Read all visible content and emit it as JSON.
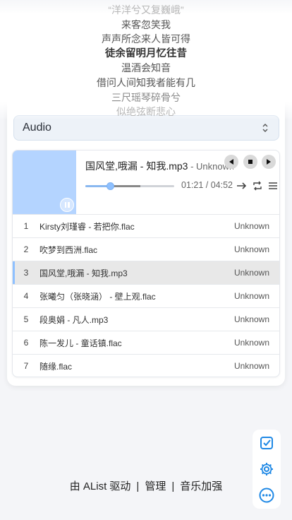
{
  "lyrics": [
    {
      "text": "“洋洋兮又复巍峨”",
      "state": "faint"
    },
    {
      "text": "来客忽笑我",
      "state": "normal"
    },
    {
      "text": "声声所念来人皆可得",
      "state": "normal"
    },
    {
      "text": "徒余留明月忆往昔",
      "state": "current"
    },
    {
      "text": "温酒会知音",
      "state": "normal"
    },
    {
      "text": "借问人间知我者能有几",
      "state": "normal"
    },
    {
      "text": "三尺瑶琴碎骨兮",
      "state": "mid"
    },
    {
      "text": "似绝弦断悲心",
      "state": "faint"
    }
  ],
  "select": {
    "label": "Audio"
  },
  "player": {
    "now_title": "国风堂,哦漏 - 知我.mp3",
    "now_artist": " - Unknown",
    "current_time": "01:21",
    "total_time": "04:52",
    "time_display": "01:21 / 04:52",
    "played_fraction": 0.28,
    "buffered_fraction": 0.62,
    "controls": [
      "previous-icon",
      "stop-icon",
      "next-icon"
    ],
    "mode_icons": [
      "order-icon",
      "loop-icon",
      "playlist-icon"
    ]
  },
  "tracks": [
    {
      "index": "1",
      "name": "Kirsty刘瑾睿 - 若把你.flac",
      "artist": "Unknown",
      "active": false
    },
    {
      "index": "2",
      "name": "吹梦到西洲.flac",
      "artist": "Unknown",
      "active": false
    },
    {
      "index": "3",
      "name": "国风堂,哦漏 - 知我.mp3",
      "artist": "Unknown",
      "active": true
    },
    {
      "index": "4",
      "name": "张曦匀（张晓涵） - 壁上观.flac",
      "artist": "Unknown",
      "active": false
    },
    {
      "index": "5",
      "name": "段奥娟 - 凡人.mp3",
      "artist": "Unknown",
      "active": false
    },
    {
      "index": "6",
      "name": "陈一发儿 - 童话镇.flac",
      "artist": "Unknown",
      "active": false
    },
    {
      "index": "7",
      "name": "随缘.flac",
      "artist": "Unknown",
      "active": false
    }
  ],
  "footer": {
    "powered": "由 AList 驱动",
    "separator": "|",
    "manage": "管理",
    "music": "音乐加强"
  },
  "float_bar": [
    "checkbox-icon",
    "settings-icon",
    "more-icon"
  ],
  "colors": {
    "accent": "#1e88e5",
    "cover": "#b4d4ff"
  }
}
